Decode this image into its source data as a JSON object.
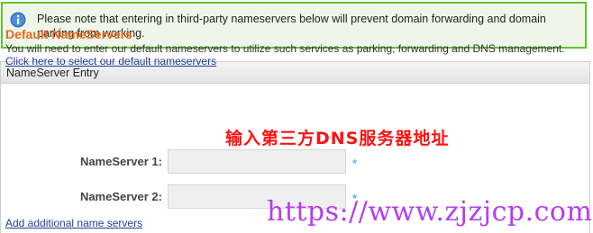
{
  "notice": {
    "icon": "info-icon",
    "text": "Please note that entering in third-party nameservers below will prevent domain forwarding and domain parking from working."
  },
  "panel": {
    "header": "NameServer Entry",
    "section_title": "Default NameServers",
    "description": "You will need to enter our default nameservers to utilize such services as parking, forwarding and DNS management.",
    "select_default_link": "Click here to select our default nameservers",
    "overlay_note": "输入第三方DNS服务器地址",
    "nameservers": [
      {
        "label": "NameServer 1:",
        "value": "",
        "required_mark": "*"
      },
      {
        "label": "NameServer 2:",
        "value": "",
        "required_mark": "*"
      }
    ],
    "add_link": "Add additional name servers"
  },
  "watermark": "https://www.zjzjcp.com",
  "colors": {
    "notice_border": "#62c531",
    "notice_bg": "#eff6e9",
    "section_title": "#e8681c",
    "link": "#1f3f9d",
    "overlay_text": "#ff1212",
    "required_mark": "#5cb9e6",
    "watermark": "#b53df0"
  }
}
